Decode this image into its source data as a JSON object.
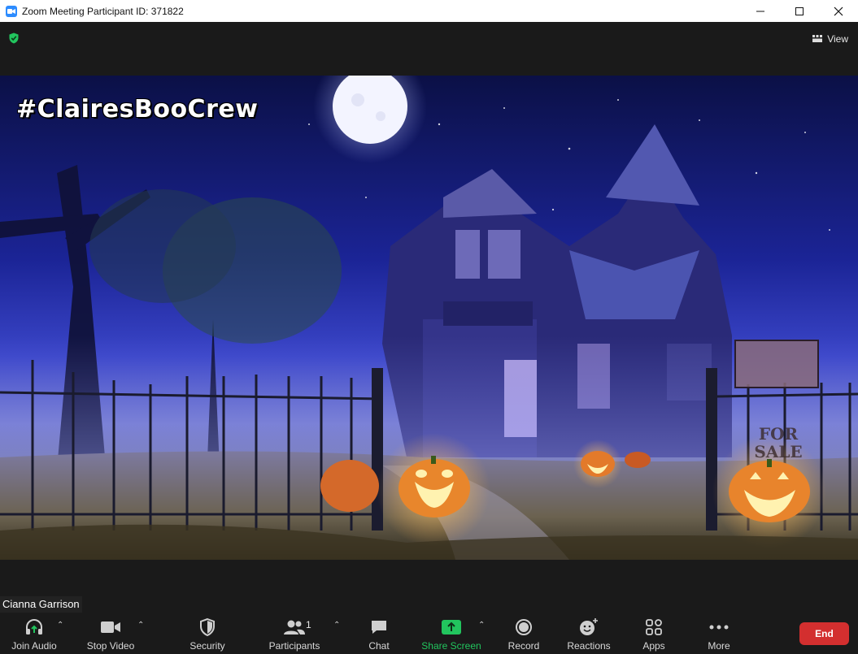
{
  "window": {
    "title": "Zoom Meeting Participant ID: 371822",
    "controls": [
      "minimize",
      "maximize",
      "close"
    ]
  },
  "topbar": {
    "view_label": "View",
    "security_indicator": "shield-check-icon"
  },
  "video": {
    "overlay_text": "#ClairesBooCrew",
    "sign_line1": "FOR",
    "sign_line2": "SALE"
  },
  "participant": {
    "name": "Cianna Garrison"
  },
  "toolbar": {
    "join_audio": "Join Audio",
    "stop_video": "Stop Video",
    "security": "Security",
    "participants": "Participants",
    "participants_count": "1",
    "chat": "Chat",
    "share_screen": "Share Screen",
    "record": "Record",
    "reactions": "Reactions",
    "apps": "Apps",
    "more": "More",
    "end": "End"
  },
  "colors": {
    "share_screen": "#22c55e",
    "end_button": "#d32f2f",
    "zoom_blue": "#2d8cff"
  }
}
